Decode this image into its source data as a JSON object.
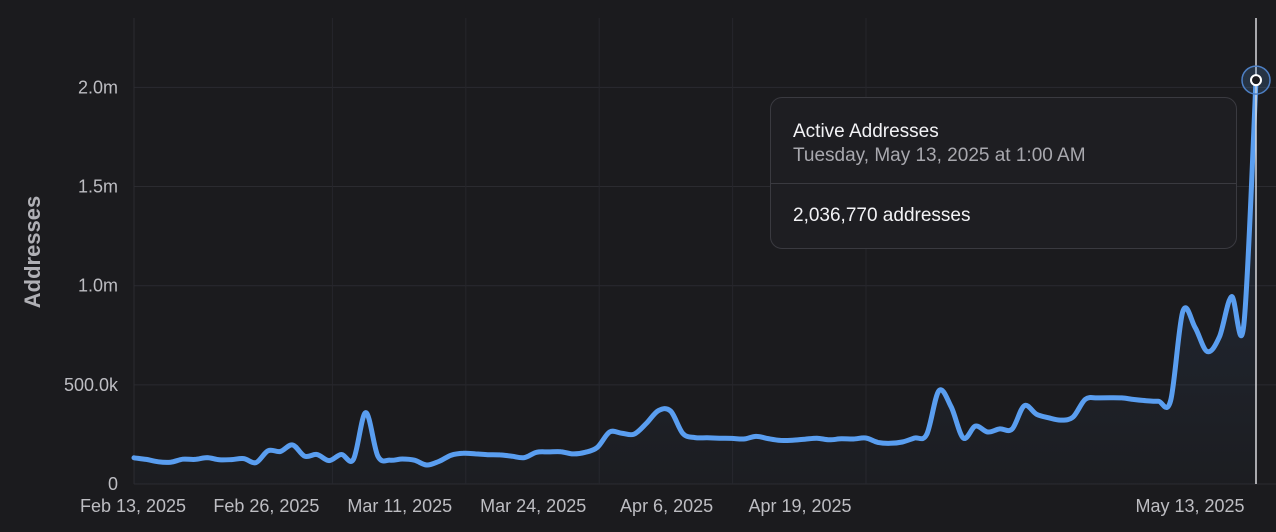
{
  "chart_data": {
    "type": "area",
    "ylabel": "Addresses",
    "ylim": [
      0,
      2350000
    ],
    "y_ticks": [
      0,
      500000,
      1000000,
      1500000,
      2000000
    ],
    "y_tick_labels": [
      "0",
      "500.0k",
      "1.0m",
      "1.5m",
      "2.0m"
    ],
    "x_tick_labels": [
      "Feb 13, 2025",
      "Feb 26, 2025",
      "Mar 11, 2025",
      "Mar 24, 2025",
      "Apr 6, 2025",
      "Apr 19, 2025",
      "May 13, 2025"
    ],
    "grid": true,
    "line_color": "#5a9ef0",
    "series": [
      {
        "values": [
          132000,
          124000,
          112000,
          110000,
          125000,
          124000,
          133000,
          122000,
          123000,
          128000,
          108000,
          168000,
          164000,
          197000,
          140000,
          149000,
          118000,
          149000,
          125000,
          360000,
          140000,
          120000,
          126000,
          120000,
          96000,
          114000,
          145000,
          155000,
          152000,
          148000,
          147000,
          140000,
          133000,
          160000,
          162000,
          163000,
          152000,
          160000,
          185000,
          262000,
          256000,
          251000,
          305000,
          370000,
          368000,
          255000,
          234000,
          233000,
          231000,
          230000,
          227000,
          240000,
          229000,
          220000,
          221000,
          226000,
          231000,
          223000,
          228000,
          227000,
          232000,
          210000,
          205000,
          212000,
          232000,
          250000,
          470000,
          390000,
          232000,
          292000,
          262000,
          278000,
          277000,
          395000,
          352000,
          334000,
          322000,
          338000,
          427000,
          434000,
          435000,
          434000,
          426000,
          420000,
          417000,
          420000,
          870000,
          790000,
          668000,
          742000,
          945000,
          802000,
          2036770
        ]
      }
    ],
    "highlight": {
      "title": "Active Addresses",
      "datetime": "Tuesday, May 13, 2025 at 1:00 AM",
      "value_text": "2,036,770 addresses"
    }
  }
}
